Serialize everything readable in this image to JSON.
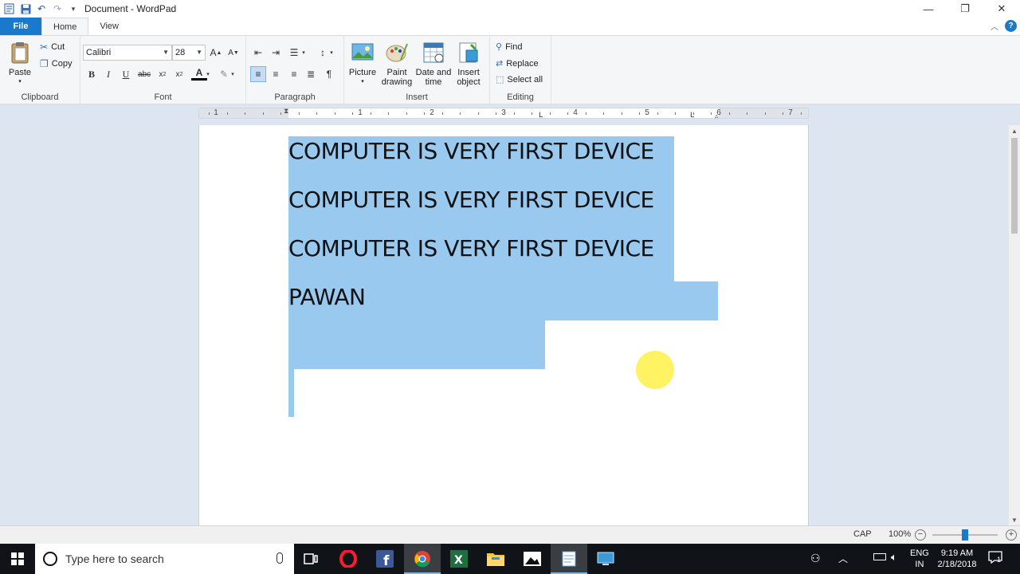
{
  "window": {
    "title": "Document - WordPad",
    "minimize_glyph": "—",
    "restore_glyph": "❐",
    "close_glyph": "✕"
  },
  "tabs": [
    {
      "label": "File"
    },
    {
      "label": "Home"
    },
    {
      "label": "View"
    }
  ],
  "ribbon": {
    "clipboard": {
      "label": "Clipboard",
      "paste": "Paste",
      "cut": "Cut",
      "copy": "Copy"
    },
    "font": {
      "label": "Font",
      "family": "Calibri",
      "size": "28"
    },
    "paragraph": {
      "label": "Paragraph"
    },
    "insert": {
      "label": "Insert",
      "picture": "Picture",
      "paint_drawing_1": "Paint",
      "paint_drawing_2": "drawing",
      "date_time_1": "Date and",
      "date_time_2": "time",
      "insert_object_1": "Insert",
      "insert_object_2": "object"
    },
    "editing": {
      "label": "Editing",
      "find": "Find",
      "replace": "Replace",
      "select_all": "Select all"
    }
  },
  "ruler": {
    "numbers": [
      "1",
      "1",
      "2",
      "3",
      "4",
      "5",
      "6",
      "7"
    ]
  },
  "document": {
    "lines": [
      "COMPUTER IS VERY FIRST DEVICE",
      "COMPUTER IS VERY FIRST DEVICE",
      "COMPUTER IS VERY FIRST DEVICE",
      "PAWAN"
    ]
  },
  "status": {
    "caps": "CAP",
    "zoom": "100%",
    "zoom_minus": "−",
    "zoom_plus": "+",
    "zoom_level": 0.5
  },
  "taskbar": {
    "search_placeholder": "Type here to search",
    "lang_1": "ENG",
    "lang_2": "IN",
    "time": "9:19 AM",
    "date": "2/18/2018",
    "notification_count": "1"
  }
}
